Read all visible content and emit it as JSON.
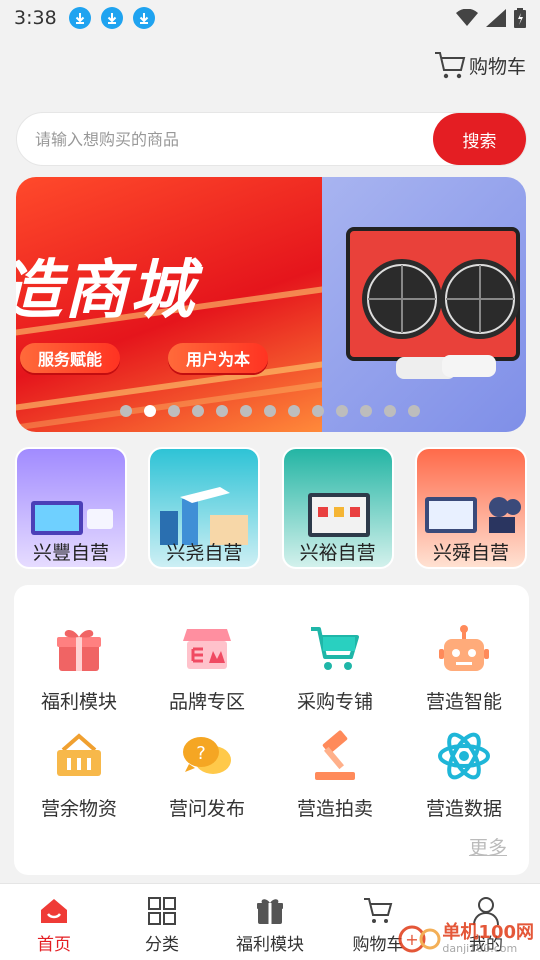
{
  "status": {
    "time": "3:38"
  },
  "header": {
    "cart_label": "购物车"
  },
  "search": {
    "placeholder": "请输入想购买的商品",
    "button_label": "搜索"
  },
  "banner": {
    "title": "造商城",
    "pills": [
      "服务赋能",
      "用户为本"
    ],
    "dot_count": 13,
    "active_index": 1
  },
  "stores": [
    {
      "label": "兴豐自营",
      "color": "#7b5cf0"
    },
    {
      "label": "兴尧自营",
      "color": "#36b6c8"
    },
    {
      "label": "兴裕自营",
      "color": "#2fb8a8"
    },
    {
      "label": "兴舜自营",
      "color": "#ff7a4a"
    }
  ],
  "grid": {
    "items": [
      {
        "label": "福利模块",
        "icon": "gift-icon"
      },
      {
        "label": "品牌专区",
        "icon": "brand-store-icon"
      },
      {
        "label": "采购专铺",
        "icon": "shopping-cart-icon"
      },
      {
        "label": "营造智能",
        "icon": "robot-icon"
      },
      {
        "label": "营余物资",
        "icon": "basket-icon"
      },
      {
        "label": "营问发布",
        "icon": "question-chat-icon"
      },
      {
        "label": "营造拍卖",
        "icon": "gavel-icon"
      },
      {
        "label": "营造数据",
        "icon": "atom-icon"
      }
    ],
    "more_label": "更多"
  },
  "tabbar": {
    "tabs": [
      {
        "label": "首页",
        "icon": "home-icon",
        "active": true
      },
      {
        "label": "分类",
        "icon": "category-grid-icon",
        "active": false
      },
      {
        "label": "福利模块",
        "icon": "gift-icon",
        "active": false
      },
      {
        "label": "购物车",
        "icon": "cart-icon",
        "active": false
      },
      {
        "label": "我的",
        "icon": "user-icon",
        "active": false
      }
    ]
  },
  "watermark": {
    "text": "单机100网",
    "url": "danji100.com"
  },
  "colors": {
    "accent": "#e41e23",
    "download_badge": "#1fa3f0"
  }
}
